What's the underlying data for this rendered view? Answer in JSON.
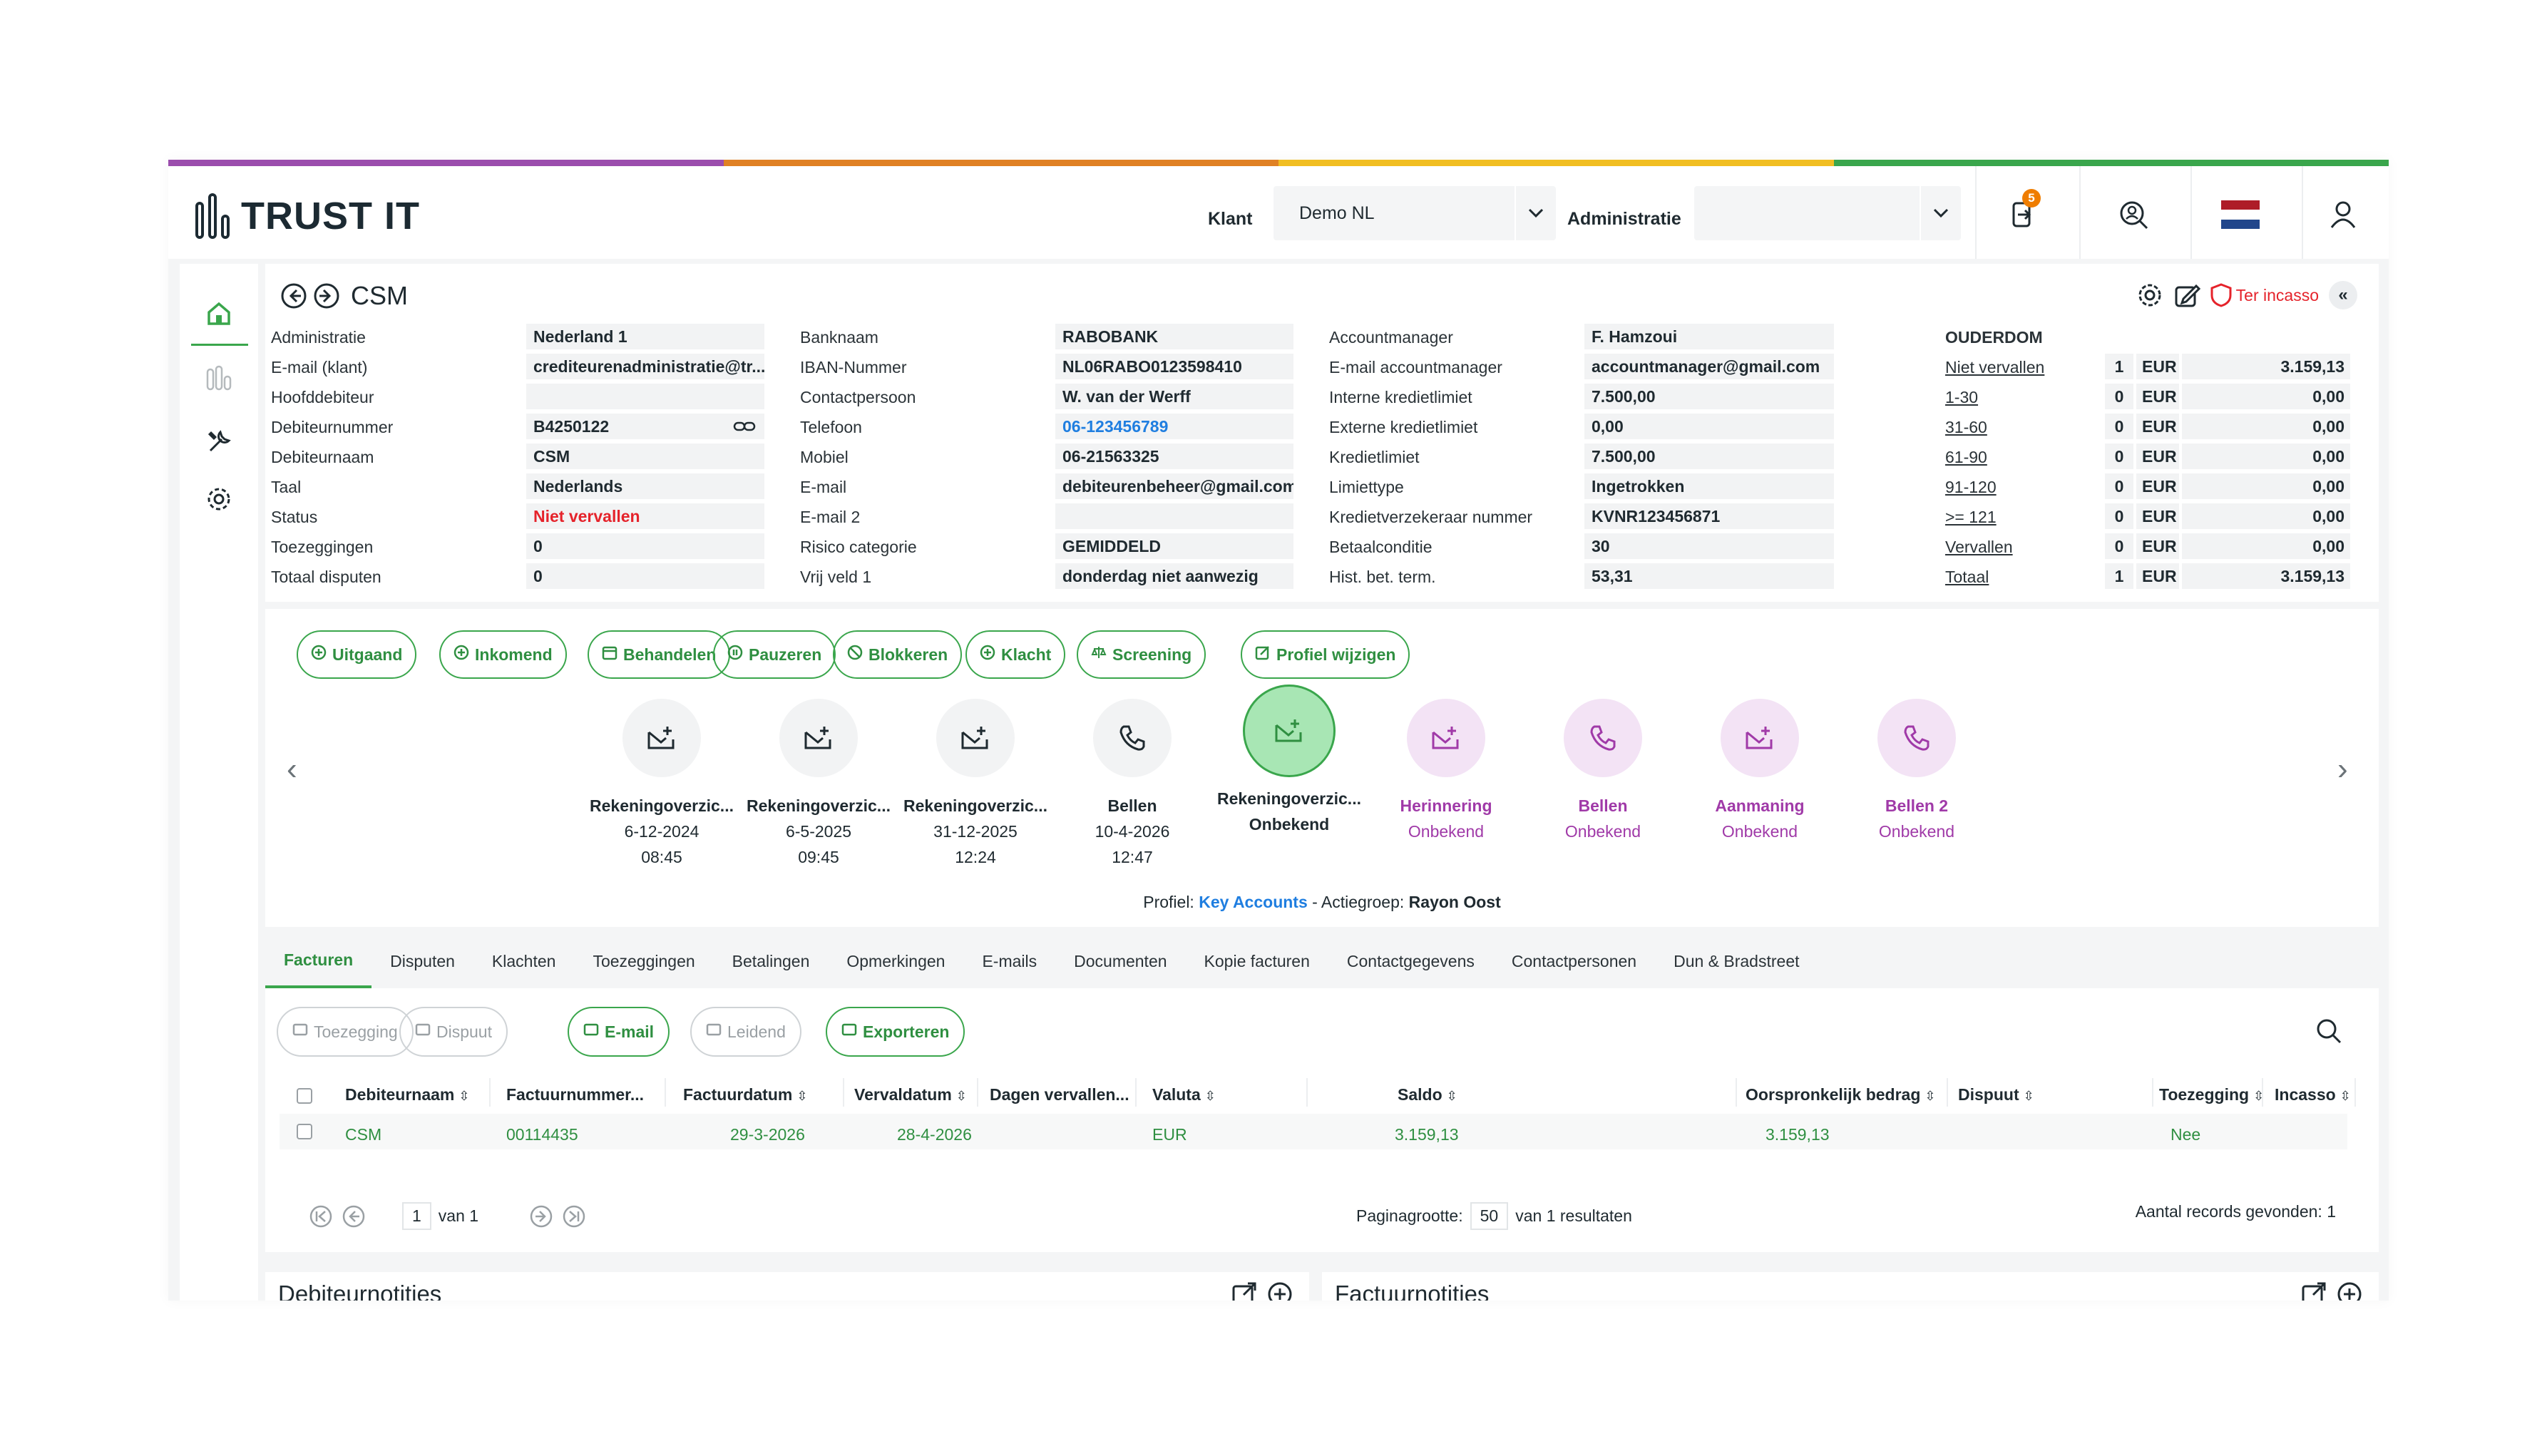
{
  "brand": {
    "name": "TRUST IT",
    "accent_colors": [
      "#9b4dad",
      "#e08124",
      "#f1be22",
      "#3aa64c"
    ],
    "primary": "#3aa64c"
  },
  "header": {
    "klant_label": "Klant",
    "klant_value": "Demo NL",
    "administratie_label": "Administratie",
    "administratie_value": "",
    "notification_count": "5",
    "icons": [
      "notification-icon",
      "search-user-icon",
      "flag-nl-icon",
      "user-icon"
    ]
  },
  "sidebar": {
    "items": [
      "home-icon",
      "dashboard-icon",
      "tools-icon",
      "settings-icon"
    ]
  },
  "debtor": {
    "title": "CSM",
    "ter_incasso": "Ter incasso",
    "col1": [
      {
        "label": "Administratie",
        "value": "Nederland 1"
      },
      {
        "label": "E-mail (klant)",
        "value": "crediteurenadministratie@tr..."
      },
      {
        "label": "Hoofddebiteur",
        "value": ""
      },
      {
        "label": "Debiteurnummer",
        "value": "B4250122"
      },
      {
        "label": "Debiteurnaam",
        "value": "CSM"
      },
      {
        "label": "Taal",
        "value": "Nederlands"
      },
      {
        "label": "Status",
        "value": "Niet vervallen"
      },
      {
        "label": "Toezeggingen",
        "value": "0"
      },
      {
        "label": "Totaal disputen",
        "value": "0"
      }
    ],
    "col2": [
      {
        "label": "Banknaam",
        "value": "RABOBANK"
      },
      {
        "label": "IBAN-Nummer",
        "value": "NL06RABO0123598410"
      },
      {
        "label": "Contactpersoon",
        "value": "W. van der Werff"
      },
      {
        "label": "Telefoon",
        "value": "06-123456789"
      },
      {
        "label": "Mobiel",
        "value": "06-21563325"
      },
      {
        "label": "E-mail",
        "value": "debiteurenbeheer@gmail.com"
      },
      {
        "label": "E-mail 2",
        "value": ""
      },
      {
        "label": "Risico categorie",
        "value": "GEMIDDELD"
      },
      {
        "label": "Vrij veld 1",
        "value": "donderdag niet aanwezig"
      }
    ],
    "col3": [
      {
        "label": "Accountmanager",
        "value": "F. Hamzoui"
      },
      {
        "label": "E-mail accountmanager",
        "value": "accountmanager@gmail.com"
      },
      {
        "label": "Interne kredietlimiet",
        "value": "7.500,00"
      },
      {
        "label": "Externe kredietlimiet",
        "value": "0,00"
      },
      {
        "label": "Kredietlimiet",
        "value": "7.500,00"
      },
      {
        "label": "Limiettype",
        "value": "Ingetrokken"
      },
      {
        "label": "Kredietverzekeraar nummer",
        "value": "KVNR123456871"
      },
      {
        "label": "Betaalconditie",
        "value": "30"
      },
      {
        "label": "Hist. bet. term.",
        "value": "53,31"
      }
    ],
    "ouderdom": {
      "title": "OUDERDOM",
      "rows": [
        {
          "label": "Niet vervallen",
          "count": "1",
          "cur": "EUR",
          "amount": "3.159,13"
        },
        {
          "label": "1-30",
          "count": "0",
          "cur": "EUR",
          "amount": "0,00"
        },
        {
          "label": "31-60",
          "count": "0",
          "cur": "EUR",
          "amount": "0,00"
        },
        {
          "label": "61-90",
          "count": "0",
          "cur": "EUR",
          "amount": "0,00"
        },
        {
          "label": "91-120",
          "count": "0",
          "cur": "EUR",
          "amount": "0,00"
        },
        {
          "label": ">= 121",
          "count": "0",
          "cur": "EUR",
          "amount": "0,00"
        },
        {
          "label": "Vervallen",
          "count": "0",
          "cur": "EUR",
          "amount": "0,00"
        },
        {
          "label": "Totaal",
          "count": "1",
          "cur": "EUR",
          "amount": "3.159,13"
        }
      ]
    }
  },
  "actions": {
    "buttons": [
      "Uitgaand",
      "Inkomend",
      "Behandelen",
      "Pauzeren",
      "Blokkeren",
      "Klacht",
      "Screening",
      "Profiel wijzigen"
    ],
    "timeline": [
      {
        "name": "Rekeningoverzic...",
        "l1": "6-12-2024",
        "l2": "08:45",
        "icon": "mail"
      },
      {
        "name": "Rekeningoverzic...",
        "l1": "6-5-2025",
        "l2": "09:45",
        "icon": "mail"
      },
      {
        "name": "Rekeningoverzic...",
        "l1": "31-12-2025",
        "l2": "12:24",
        "icon": "mail"
      },
      {
        "name": "Bellen",
        "l1": "10-4-2026",
        "l2": "12:47",
        "icon": "phone"
      },
      {
        "name": "Rekeningoverzic...",
        "l1": "Onbekend",
        "l2": "",
        "icon": "mail"
      },
      {
        "name": "Herinnering",
        "l1": "Onbekend",
        "l2": "",
        "icon": "mail"
      },
      {
        "name": "Bellen",
        "l1": "Onbekend",
        "l2": "",
        "icon": "phone"
      },
      {
        "name": "Aanmaning",
        "l1": "Onbekend",
        "l2": "",
        "icon": "mail"
      },
      {
        "name": "Bellen 2",
        "l1": "Onbekend",
        "l2": "",
        "icon": "phone"
      }
    ],
    "profile_prefix": "Profiel:",
    "profile_value": "Key Accounts",
    "group_prefix": "- Actiegroep:",
    "group_value": "Rayon Oost"
  },
  "tabs": [
    "Facturen",
    "Disputen",
    "Klachten",
    "Toezeggingen",
    "Betalingen",
    "Opmerkingen",
    "E-mails",
    "Documenten",
    "Kopie facturen",
    "Contactgegevens",
    "Contactpersonen",
    "Dun & Bradstreet"
  ],
  "table": {
    "toolbar": [
      "Toezegging",
      "Dispuut",
      "E-mail",
      "Leidend",
      "Exporteren"
    ],
    "headers": [
      "Debiteurnaam",
      "Factuurnummer...",
      "Factuurdatum",
      "Vervaldatum",
      "Dagen vervallen...",
      "Valuta",
      "Saldo",
      "Oorspronkelijk bedrag",
      "Dispuut",
      "Toezegging",
      "Incasso"
    ],
    "row": {
      "debiteurnaam": "CSM",
      "factuurnummer": "00114435",
      "factuurdatum": "29-3-2026",
      "vervaldatum": "28-4-2026",
      "valuta": "EUR",
      "saldo": "3.159,13",
      "oorspronkelijk": "3.159,13",
      "incasso": "Nee"
    },
    "pager": {
      "page": "1",
      "of_label": "van 1",
      "size_label": "Paginagrootte:",
      "size": "50",
      "results": "van 1 resultaten",
      "records": "Aantal records gevonden: 1"
    }
  },
  "notes": {
    "left_title": "Debiteurnotities",
    "right_title": "Factuurnotities"
  }
}
